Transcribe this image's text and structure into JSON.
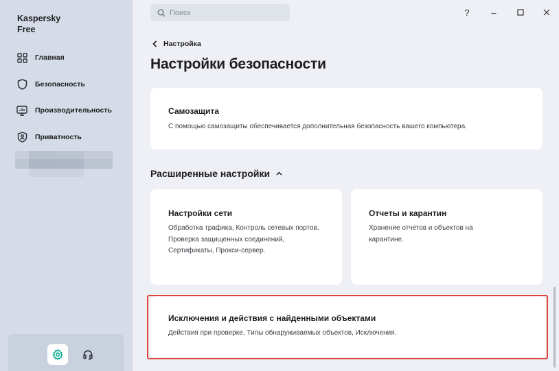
{
  "sidebar": {
    "brand": "Kaspersky\nFree",
    "items": [
      {
        "label": "Главная",
        "icon": "home-grid-icon"
      },
      {
        "label": "Безопасность",
        "icon": "shield-icon"
      },
      {
        "label": "Производительность",
        "icon": "monitor-icon"
      },
      {
        "label": "Приватность",
        "icon": "privacy-shield-icon"
      }
    ],
    "bottom": {
      "settings_icon": "gear-icon",
      "support_icon": "headset-icon"
    }
  },
  "search": {
    "placeholder": "Поиск"
  },
  "window_controls": {
    "help": "?",
    "minimize": "–",
    "maximize": "☐",
    "close": "✕"
  },
  "breadcrumb": {
    "back": "Настройка"
  },
  "page": {
    "title": "Настройки безопасности"
  },
  "self_protection": {
    "title": "Самозащита",
    "description": "С помощью самозащиты обеспечивается дополнительная безопасность вашего компьютера."
  },
  "advanced": {
    "header": "Расширенные настройки",
    "cards": [
      {
        "title": "Настройки сети",
        "description": "Обработка трафика, Контроль сетевых портов, Проверка защищенных соединений, Сертификаты, Прокси-сервер."
      },
      {
        "title": "Отчеты и карантин",
        "description": "Хранение отчетов и объектов на карантине."
      },
      {
        "title": "Исключения и действия с найденными объектами",
        "description": "Действия при проверке, Типы обнаруживаемых объектов, Исключения."
      }
    ]
  },
  "colors": {
    "accent": "#00a88e",
    "highlight": "#e0443a",
    "sidebar": "#d6dce7",
    "background": "#eef0f5"
  }
}
